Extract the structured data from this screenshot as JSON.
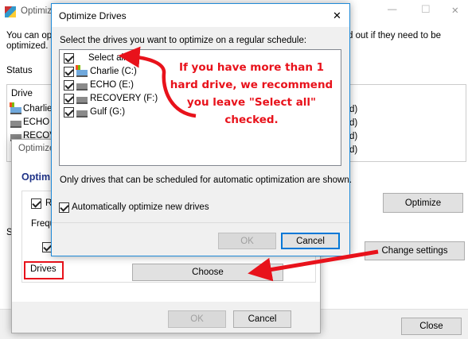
{
  "main_window": {
    "title": "Optimize Drives",
    "title_visible": "Optimiz",
    "intro_left": "You can opti",
    "intro_left2": "optimized. O",
    "intro_right": "d out if they need to be",
    "status_label": "Status",
    "drive_header": "Drive",
    "drives": [
      "Charlie",
      "ECHO (E",
      "RECOVERY"
    ],
    "drive_status_suffix": [
      "d)",
      "d)",
      "d)",
      "d)"
    ],
    "schedule_label": "S",
    "analyze_partial": "",
    "optimize_button": "Optimize",
    "change_settings_button": "Change settings",
    "close_button": "Close"
  },
  "schedule_dialog": {
    "title": "Optimize",
    "heading": "Optimiz",
    "run_on_schedule_partial": "R",
    "frequency_partial": "Frequ",
    "drives_label": "Drives",
    "choose_button": "Choose",
    "ok_button": "OK",
    "cancel_button": "Cancel"
  },
  "select_dialog": {
    "title": "Optimize Drives",
    "close_glyph": "✕",
    "instruction": "Select the drives you want to optimize on a regular schedule:",
    "items": [
      {
        "label": "Select all",
        "checked": true
      },
      {
        "label": "Charlie (C:)",
        "checked": true
      },
      {
        "label": "ECHO (E:)",
        "checked": true
      },
      {
        "label": "RECOVERY (F:)",
        "checked": true
      },
      {
        "label": "Gulf (G:)",
        "checked": true
      }
    ],
    "note": "Only drives that can be scheduled for automatic optimization are shown.",
    "auto_optimize_label": "Automatically optimize new drives",
    "auto_optimize_checked": true,
    "ok_button": "OK",
    "cancel_button": "Cancel"
  },
  "annotation": {
    "text_lines": [
      "If you have more than 1",
      "hard drive, we recommend",
      "you leave \"Select all\"",
      "checked."
    ],
    "color": "#e8121b"
  },
  "window_controls": {
    "minimize": "—",
    "maximize": "☐",
    "close": "✕"
  }
}
